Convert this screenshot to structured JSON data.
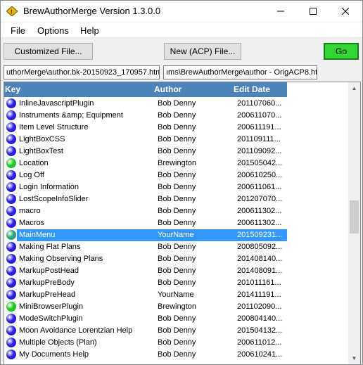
{
  "window": {
    "title": "BrewAuthorMerge Version 1.3.0.0"
  },
  "menu": [
    "File",
    "Options",
    "Help"
  ],
  "toolbar": {
    "customized_label": "Customized File...",
    "new_acp_label": "New (ACP) File...",
    "go_label": "Go"
  },
  "paths": {
    "left": "uthorMerge\\author.bk-20150923_170957.html",
    "right": "ıms\\BrewAuthorMerge\\author - OrigACP8.html"
  },
  "table": {
    "headers": {
      "key": "Key",
      "author": "Author",
      "date": "Edit Date"
    },
    "rows": [
      {
        "key": "InlineJavascriptPlugin",
        "author": "Bob Denny",
        "date": "201107060...",
        "status": "blue"
      },
      {
        "key": "Instruments &amp; Equipment",
        "author": "Bob Denny",
        "date": "200611070...",
        "status": "blue"
      },
      {
        "key": "Item Level Structure",
        "author": "Bob Denny",
        "date": "200611191...",
        "status": "blue"
      },
      {
        "key": "LightBoxCSS",
        "author": "Bob Denny",
        "date": "201109111...",
        "status": "blue"
      },
      {
        "key": "LightBoxTest",
        "author": "Bob Denny",
        "date": "201109092...",
        "status": "blue"
      },
      {
        "key": "Location",
        "author": "Brewington",
        "date": "201505042...",
        "status": "green"
      },
      {
        "key": "Log Off",
        "author": "Bob Denny",
        "date": "200610250...",
        "status": "blue"
      },
      {
        "key": "Login Information",
        "author": "Bob Denny",
        "date": "200611061...",
        "status": "blue"
      },
      {
        "key": "LostScopeInfoSlider",
        "author": "Bob Denny",
        "date": "201207070...",
        "status": "blue"
      },
      {
        "key": "macro",
        "author": "Bob Denny",
        "date": "200611302...",
        "status": "blue"
      },
      {
        "key": "Macros",
        "author": "Bob Denny",
        "date": "200611302...",
        "status": "blue"
      },
      {
        "key": "MainMenu",
        "author": "YourName",
        "date": "201509231...",
        "status": "teal",
        "selected": true
      },
      {
        "key": "Making Flat Plans",
        "author": "Bob Denny",
        "date": "200805092...",
        "status": "blue"
      },
      {
        "key": "Making Observing Plans",
        "author": "Bob Denny",
        "date": "201408140...",
        "status": "blue"
      },
      {
        "key": "MarkupPostHead",
        "author": "Bob Denny",
        "date": "201408091...",
        "status": "blue"
      },
      {
        "key": "MarkupPreBody",
        "author": "Bob Denny",
        "date": "201011161...",
        "status": "blue"
      },
      {
        "key": "MarkupPreHead",
        "author": "YourName",
        "date": "201411191...",
        "status": "blue"
      },
      {
        "key": "MiniBrowserPlugin",
        "author": "Brewington",
        "date": "201102090...",
        "status": "green"
      },
      {
        "key": "ModeSwitchPlugin",
        "author": "Bob Denny",
        "date": "200804140...",
        "status": "blue"
      },
      {
        "key": "Moon Avoidance Lorentzian Help",
        "author": "Bob Denny",
        "date": "201504132...",
        "status": "blue"
      },
      {
        "key": "Multiple Objects (Plan)",
        "author": "Bob Denny",
        "date": "200611012...",
        "status": "blue"
      },
      {
        "key": "My Documents Help",
        "author": "Bob Denny",
        "date": "200610241...",
        "status": "blue"
      }
    ]
  },
  "colors": {
    "blue": "#2a1fe0",
    "green": "#1fc41f",
    "teal": "#2aa37a",
    "header": "#4c84ba",
    "selection": "#3399ff"
  }
}
